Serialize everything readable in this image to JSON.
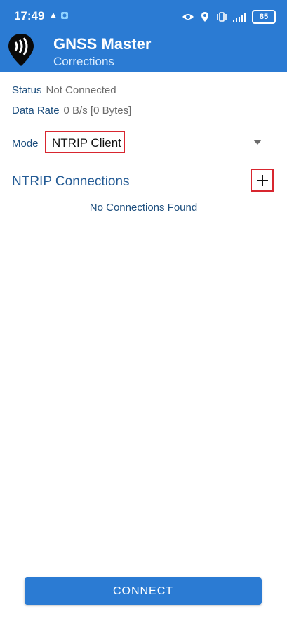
{
  "status_bar": {
    "time": "17:49",
    "battery": "85",
    "icons": [
      "notification-icon",
      "app-notification-icon",
      "eye-icon",
      "location-icon",
      "vibrate-icon",
      "signal-icon"
    ]
  },
  "app_bar": {
    "title": "GNSS Master",
    "subtitle": "Corrections",
    "color": "#2b7bd3",
    "logo_icon": "gnss-pin-logo-icon"
  },
  "info": {
    "status_label": "Status",
    "status_value": "Not Connected",
    "rate_label": "Data Rate",
    "rate_value": "0 B/s [0 Bytes]"
  },
  "mode": {
    "label": "Mode",
    "selected": "NTRIP Client",
    "icon": "dropdown-arrow-icon"
  },
  "connections": {
    "title": "NTRIP Connections",
    "add_icon": "plus-icon",
    "empty_text": "No Connections Found"
  },
  "actions": {
    "connect_label": "CONNECT"
  },
  "highlight_color": "#d8262f"
}
